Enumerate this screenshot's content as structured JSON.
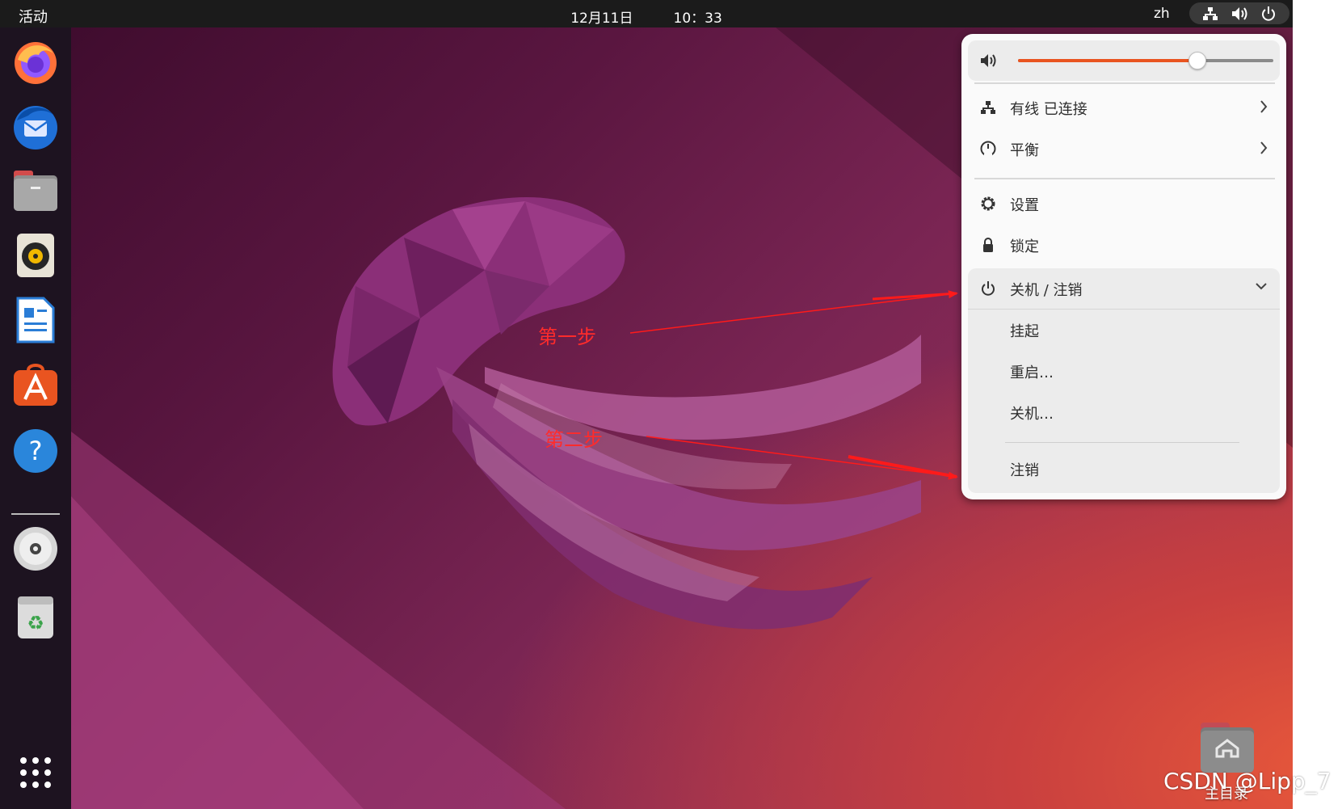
{
  "topbar": {
    "activities": "活动",
    "date": "12月11日",
    "time": "10：33",
    "language": "zh",
    "icons": [
      "network-wired-icon",
      "speaker-icon",
      "power-icon"
    ]
  },
  "dock": {
    "apps": [
      {
        "name": "firefox-icon"
      },
      {
        "name": "thunderbird-icon"
      },
      {
        "name": "files-icon"
      },
      {
        "name": "rhythmbox-icon"
      },
      {
        "name": "libreoffice-writer-icon"
      },
      {
        "name": "ubuntu-software-icon"
      },
      {
        "name": "help-icon"
      },
      {
        "name": "disc-icon"
      },
      {
        "name": "trash-icon"
      },
      {
        "name": "show-apps-grid-icon"
      }
    ]
  },
  "desktop": {
    "home_folder_label": "主目录"
  },
  "menu": {
    "volume_percent": 70,
    "network_label": "有线 已连接",
    "power_mode_label": "平衡",
    "settings_label": "设置",
    "lock_label": "锁定",
    "power_header_label": "关机 / 注销",
    "power_options": {
      "suspend": "挂起",
      "restart": "重启…",
      "shutdown": "关机…",
      "logout": "注销"
    }
  },
  "annotations": {
    "step1": "第一步",
    "step2": "第二步",
    "arrow_color": "#ff1a1a"
  },
  "watermark": "CSDN @Lipp_7",
  "colors": {
    "accent": "#e95420",
    "topbar": "#1b1b1b",
    "dock": "#1d1320"
  }
}
